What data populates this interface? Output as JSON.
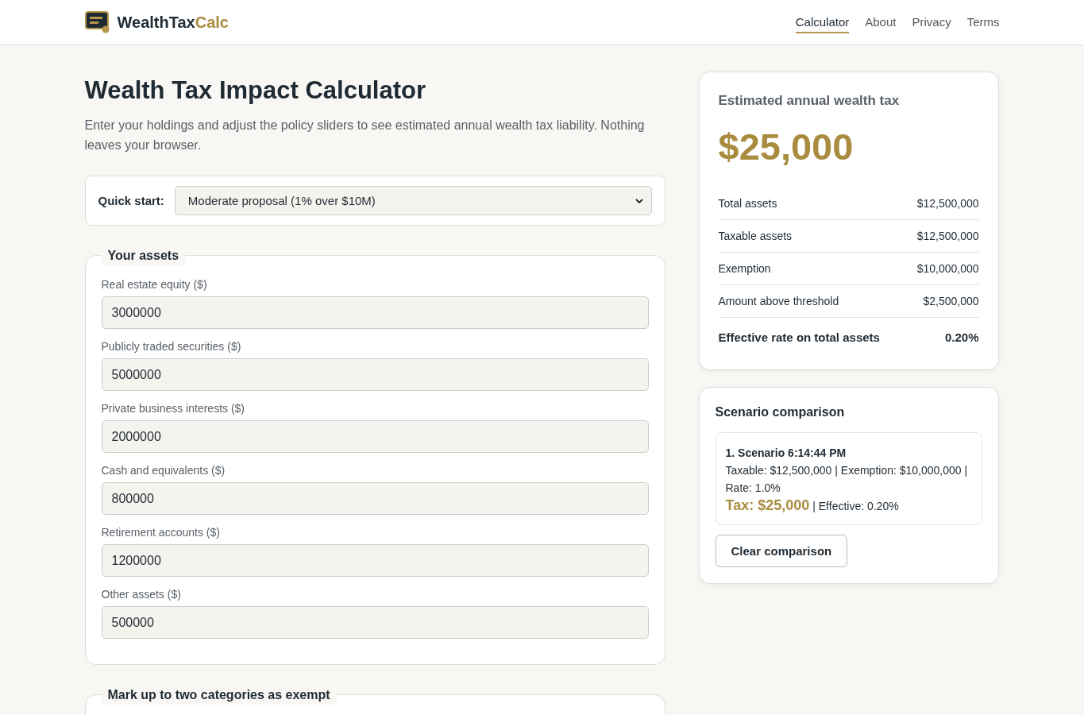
{
  "brand": {
    "name": "WealthTax",
    "accent": "Calc"
  },
  "nav": [
    {
      "label": "Calculator",
      "selected": true
    },
    {
      "label": "About",
      "selected": false
    },
    {
      "label": "Privacy",
      "selected": false
    },
    {
      "label": "Terms",
      "selected": false
    }
  ],
  "title": "Wealth Tax Impact Calculator",
  "intro": "Enter your holdings and adjust the policy sliders to see estimated annual wealth tax liability. Nothing leaves your browser.",
  "quick_start": {
    "label": "Quick start:",
    "value": "Moderate proposal (1% over $10M)"
  },
  "assets": {
    "legend": "Your assets",
    "fields": [
      {
        "label": "Real estate equity ($)",
        "value": "3000000"
      },
      {
        "label": "Publicly traded securities ($)",
        "value": "5000000"
      },
      {
        "label": "Private business interests ($)",
        "value": "2000000"
      },
      {
        "label": "Cash and equivalents ($)",
        "value": "800000"
      },
      {
        "label": "Retirement accounts ($)",
        "value": "1200000"
      },
      {
        "label": "Other assets ($)",
        "value": "500000"
      }
    ]
  },
  "exempt": {
    "legend": "Mark up to two categories as exempt"
  },
  "result": {
    "heading": "Estimated annual wealth tax",
    "amount": "$25,000",
    "rows": [
      {
        "label": "Total assets",
        "value": "$12,500,000",
        "kind": "normal"
      },
      {
        "label": "Taxable assets",
        "value": "$12,500,000",
        "kind": "normal"
      },
      {
        "label": "Exemption",
        "value": "$10,000,000",
        "kind": "normal"
      },
      {
        "label": "Amount above threshold",
        "value": "$2,500,000",
        "kind": "normal"
      },
      {
        "label": "Effective rate on total assets",
        "value": "0.20%",
        "kind": "total"
      }
    ]
  },
  "comparison": {
    "heading": "Scenario comparison",
    "scenarios": [
      {
        "title": "1. Scenario 6:14:44 PM",
        "details": "Taxable: $12,500,000 | Exemption: $10,000,000 | Rate: 1.0%",
        "tax": "Tax: $25,000",
        "effective": "| Effective: 0.20%"
      }
    ],
    "button": "Clear comparison"
  }
}
